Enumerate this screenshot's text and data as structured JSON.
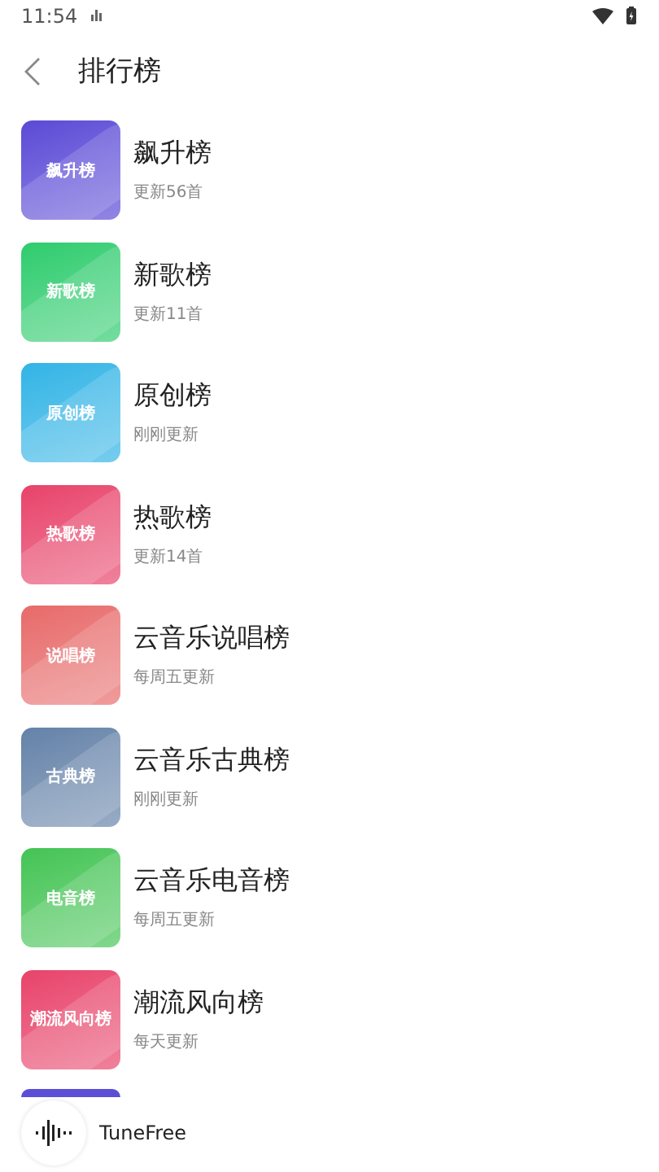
{
  "status_bar": {
    "time": "11:54"
  },
  "header": {
    "title": "排行榜"
  },
  "items": [
    {
      "title": "飙升榜",
      "subtitle": "更新56首",
      "cover_label": "飙升榜",
      "color": "#5a4ad6"
    },
    {
      "title": "新歌榜",
      "subtitle": "更新11首",
      "cover_label": "新歌榜",
      "color": "#2fcc6e"
    },
    {
      "title": "原创榜",
      "subtitle": "刚刚更新",
      "cover_label": "原创榜",
      "color": "#32b4e6"
    },
    {
      "title": "热歌榜",
      "subtitle": "更新14首",
      "cover_label": "热歌榜",
      "color": "#e8436a"
    },
    {
      "title": "云音乐说唱榜",
      "subtitle": "每周五更新",
      "cover_label": "说唱榜",
      "color": "#e86a6a"
    },
    {
      "title": "云音乐古典榜",
      "subtitle": "刚刚更新",
      "cover_label": "古典榜",
      "color": "#6482a8"
    },
    {
      "title": "云音乐电音榜",
      "subtitle": "每周五更新",
      "cover_label": "电音榜",
      "color": "#44c454"
    },
    {
      "title": "潮流风向榜",
      "subtitle": "每天更新",
      "cover_label": "潮流风向榜",
      "color": "#e8436a"
    },
    {
      "color": "#5b4fd8"
    }
  ],
  "player": {
    "track": "TuneFree"
  }
}
